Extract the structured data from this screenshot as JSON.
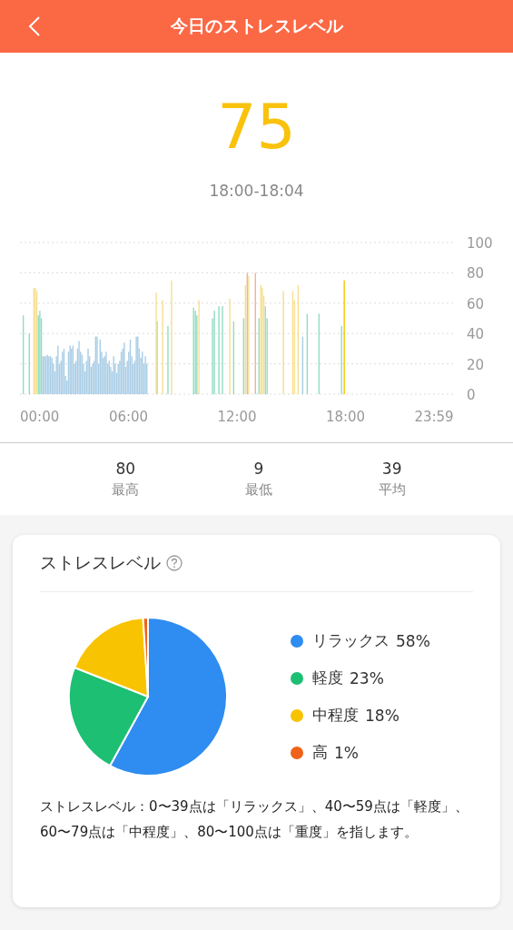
{
  "header": {
    "title": "今日のストレスレベル"
  },
  "score": {
    "value": "75",
    "time_range": "18:00-18:04"
  },
  "timeline": {
    "chart_data": {
      "type": "bar",
      "grid": true,
      "x": [
        11,
        31,
        46,
        51,
        56,
        61,
        66,
        71,
        76,
        81,
        86,
        91,
        96,
        101,
        106,
        111,
        116,
        121,
        126,
        131,
        136,
        141,
        146,
        151,
        156,
        161,
        166,
        171,
        176,
        181,
        186,
        191,
        196,
        201,
        206,
        211,
        216,
        221,
        226,
        231,
        236,
        241,
        246,
        251,
        256,
        261,
        266,
        271,
        276,
        281,
        286,
        291,
        296,
        301,
        306,
        311,
        316,
        321,
        326,
        331,
        336,
        341,
        346,
        351,
        356,
        361,
        366,
        371,
        376,
        381,
        386,
        391,
        396,
        401,
        406,
        411,
        416,
        421,
        452,
        455,
        473,
        491,
        503,
        576,
        582,
        587,
        594,
        639,
        645,
        660,
        672,
        696,
        709,
        742,
        748,
        754,
        759,
        781,
        793,
        799,
        804,
        809,
        814,
        820,
        874,
        905,
        911,
        923,
        938,
        953,
        992,
        1067,
        1076
      ],
      "series": [
        {
          "color": "#a9cde6",
          "values": [
            null,
            null,
            null,
            null,
            null,
            null,
            null,
            null,
            25,
            25,
            25,
            26,
            25,
            25,
            24,
            20,
            15,
            25,
            32,
            20,
            22,
            28,
            30,
            12,
            9,
            28,
            32,
            30,
            32,
            20,
            22,
            30,
            35,
            28,
            26,
            20,
            15,
            22,
            30,
            25,
            18,
            20,
            22,
            38,
            38,
            20,
            36,
            28,
            24,
            25,
            28,
            20,
            22,
            18,
            15,
            25,
            20,
            14,
            20,
            22,
            28,
            30,
            34,
            18,
            22,
            28,
            36,
            25,
            20,
            22,
            38,
            38,
            30,
            24,
            28,
            20,
            25,
            20,
            null,
            null,
            null,
            null,
            null,
            null,
            null,
            null,
            null,
            null,
            null,
            null,
            null,
            null,
            null,
            null,
            null,
            null,
            null,
            null,
            null,
            null,
            null,
            null,
            null,
            null,
            null,
            null,
            null,
            null,
            38,
            null,
            null,
            null,
            null
          ]
        },
        {
          "color": "#93dcc3",
          "values": [
            52,
            40,
            null,
            null,
            null,
            52,
            55,
            50,
            null,
            null,
            null,
            null,
            null,
            null,
            null,
            null,
            null,
            null,
            null,
            null,
            null,
            null,
            null,
            null,
            null,
            null,
            null,
            null,
            null,
            null,
            null,
            null,
            null,
            null,
            null,
            null,
            null,
            null,
            null,
            null,
            null,
            null,
            null,
            null,
            null,
            null,
            null,
            null,
            null,
            null,
            null,
            null,
            null,
            null,
            null,
            null,
            null,
            null,
            null,
            null,
            null,
            null,
            null,
            null,
            null,
            null,
            null,
            null,
            null,
            null,
            null,
            null,
            null,
            null,
            null,
            null,
            null,
            null,
            null,
            48,
            null,
            45,
            null,
            57,
            55,
            52,
            null,
            50,
            55,
            58,
            58,
            null,
            48,
            50,
            null,
            null,
            null,
            null,
            50,
            null,
            null,
            null,
            58,
            50,
            null,
            null,
            null,
            null,
            null,
            53,
            53,
            45,
            null
          ]
        },
        {
          "color": "#f6df90",
          "values": [
            null,
            null,
            70,
            70,
            68,
            null,
            null,
            null,
            null,
            null,
            null,
            null,
            null,
            null,
            null,
            null,
            null,
            null,
            null,
            null,
            null,
            null,
            null,
            null,
            null,
            null,
            null,
            null,
            null,
            null,
            null,
            null,
            null,
            null,
            null,
            null,
            null,
            null,
            null,
            null,
            null,
            null,
            null,
            null,
            null,
            null,
            null,
            null,
            null,
            null,
            null,
            null,
            null,
            null,
            null,
            null,
            null,
            null,
            null,
            null,
            null,
            null,
            null,
            null,
            null,
            null,
            null,
            null,
            null,
            null,
            null,
            null,
            null,
            null,
            null,
            null,
            null,
            null,
            67,
            null,
            62,
            null,
            75,
            null,
            null,
            null,
            62,
            null,
            null,
            null,
            null,
            63,
            null,
            null,
            72,
            null,
            78,
            null,
            null,
            72,
            70,
            65,
            null,
            null,
            68,
            68,
            62,
            72,
            null,
            null,
            null,
            null,
            null
          ]
        },
        {
          "color": "#f3b48e",
          "values": [
            null,
            null,
            null,
            null,
            null,
            null,
            null,
            null,
            null,
            null,
            null,
            null,
            null,
            null,
            null,
            null,
            null,
            null,
            null,
            null,
            null,
            null,
            null,
            null,
            null,
            null,
            null,
            null,
            null,
            null,
            null,
            null,
            null,
            null,
            null,
            null,
            null,
            null,
            null,
            null,
            null,
            null,
            null,
            null,
            null,
            null,
            null,
            null,
            null,
            null,
            null,
            null,
            null,
            null,
            null,
            null,
            null,
            null,
            null,
            null,
            null,
            null,
            null,
            null,
            null,
            null,
            null,
            null,
            null,
            null,
            null,
            null,
            null,
            null,
            null,
            null,
            null,
            null,
            null,
            null,
            null,
            null,
            null,
            null,
            null,
            null,
            null,
            null,
            null,
            null,
            null,
            null,
            null,
            null,
            null,
            80,
            null,
            80,
            null,
            null,
            null,
            null,
            null,
            null,
            null,
            null,
            null,
            null,
            null,
            null,
            null,
            null,
            null
          ]
        },
        {
          "color": "#f8c300",
          "values": [
            null,
            null,
            null,
            null,
            null,
            null,
            null,
            null,
            null,
            null,
            null,
            null,
            null,
            null,
            null,
            null,
            null,
            null,
            null,
            null,
            null,
            null,
            null,
            null,
            null,
            null,
            null,
            null,
            null,
            null,
            null,
            null,
            null,
            null,
            null,
            null,
            null,
            null,
            null,
            null,
            null,
            null,
            null,
            null,
            null,
            null,
            null,
            null,
            null,
            null,
            null,
            null,
            null,
            null,
            null,
            null,
            null,
            null,
            null,
            null,
            null,
            null,
            null,
            null,
            null,
            null,
            null,
            null,
            null,
            null,
            null,
            null,
            null,
            null,
            null,
            null,
            null,
            null,
            null,
            null,
            null,
            null,
            null,
            null,
            null,
            null,
            null,
            null,
            null,
            null,
            null,
            null,
            null,
            null,
            null,
            null,
            null,
            null,
            null,
            null,
            null,
            null,
            null,
            null,
            null,
            null,
            null,
            null,
            null,
            null,
            null,
            null,
            75
          ]
        }
      ],
      "xlim": [
        0,
        1440
      ],
      "ylim": [
        0,
        100
      ],
      "xticks": [
        {
          "value": 0,
          "label": "00:00"
        },
        {
          "value": 360,
          "label": "06:00"
        },
        {
          "value": 720,
          "label": "12:00"
        },
        {
          "value": 1080,
          "label": "18:00"
        },
        {
          "value": 1439,
          "label": "23:59"
        }
      ],
      "yticks": [
        0,
        20,
        40,
        60,
        80,
        100
      ]
    }
  },
  "stats": [
    {
      "value": "80",
      "label": "最高"
    },
    {
      "value": "9",
      "label": "最低"
    },
    {
      "value": "39",
      "label": "平均"
    }
  ],
  "card": {
    "title": "ストレスレベル",
    "chart_data": {
      "type": "pie",
      "categories": [
        "リラックス",
        "軽度",
        "中程度",
        "高"
      ],
      "values": [
        58,
        23,
        18,
        1
      ],
      "value_labels": [
        "58%",
        "23%",
        "18%",
        "1%"
      ],
      "colors": [
        "#2f8cf0",
        "#1dbf73",
        "#f8c300",
        "#f0621a"
      ]
    },
    "description": "ストレスレベル：0〜39点は「リラックス」、40〜59点は「軽度」、60〜79点は「中程度」、80〜100点は「重度」を指します。"
  }
}
